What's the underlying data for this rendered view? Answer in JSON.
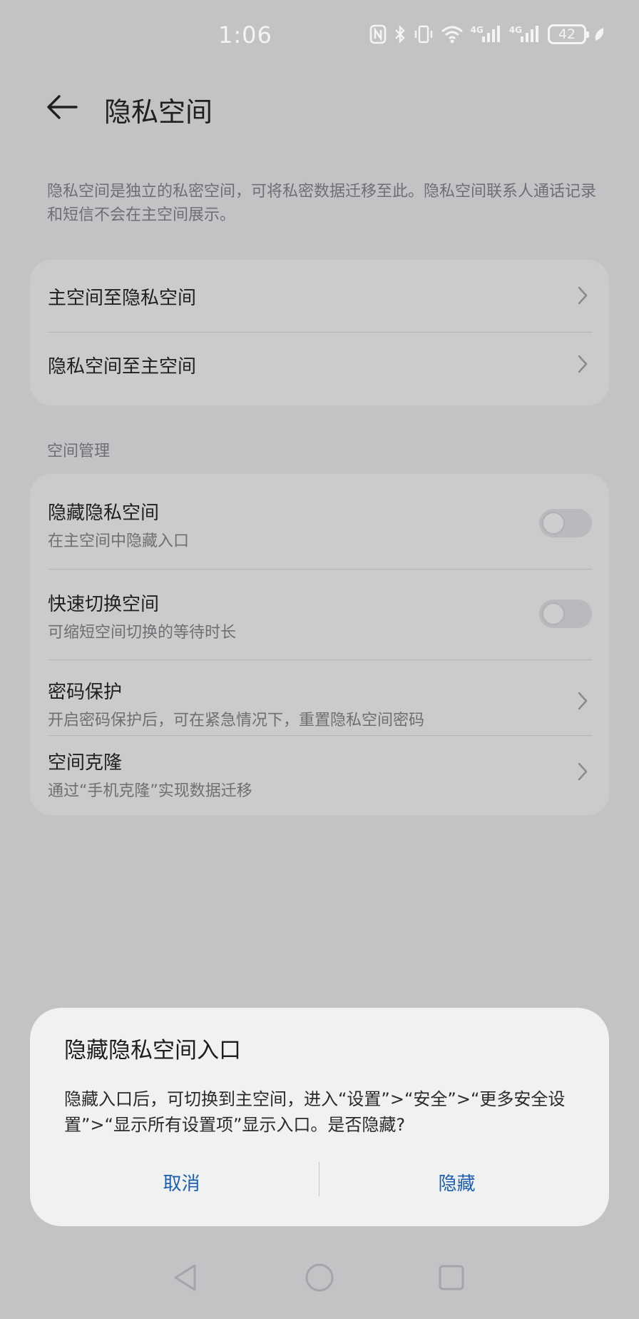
{
  "status_bar": {
    "time": "1:06",
    "battery": "42",
    "signal1_label": "4G",
    "signal2_label": "4G",
    "icons": [
      "nfc-icon",
      "bluetooth-icon",
      "vibrate-icon",
      "wifi-icon",
      "signal-icon",
      "signal-icon",
      "battery-icon",
      "leaf-icon"
    ]
  },
  "header": {
    "title": "隐私空间",
    "back_icon": "arrow-left-icon"
  },
  "intro": {
    "text": "隐私空间是独立的私密空间，可将私密数据迁移至此。隐私空间联系人通话记录和短信不会在主空间展示。"
  },
  "transfer": {
    "items": [
      {
        "title": "主空间至隐私空间"
      },
      {
        "title": "隐私空间至主空间"
      }
    ]
  },
  "space_management": {
    "label": "空间管理",
    "items": [
      {
        "title": "隐藏隐私空间",
        "subtitle": "在主空间中隐藏入口",
        "control": "toggle",
        "on": false
      },
      {
        "title": "快速切换空间",
        "subtitle": "可缩短空间切换的等待时长",
        "control": "toggle",
        "on": false
      },
      {
        "title": "密码保护",
        "subtitle": "开启密码保护后，可在紧急情况下，重置隐私空间密码",
        "control": "chevron"
      },
      {
        "title": "空间克隆",
        "subtitle": "通过“手机克隆”实现数据迁移",
        "control": "chevron"
      }
    ]
  },
  "dialog": {
    "title": "隐藏隐私空间入口",
    "body": "隐藏入口后，可切换到主空间，进入“设置”>“安全”>“更多安全设置”>“显示所有设置项”显示入口。是否隐藏?",
    "cancel_label": "取消",
    "confirm_label": "隐藏"
  },
  "colors": {
    "background": "#c2c3c5",
    "card": "#cbcbcc",
    "dialog": "#f0f1f1",
    "accent": "#1f5fb0"
  },
  "nav_bar": {
    "icons": [
      "back-triangle-icon",
      "home-circle-icon",
      "recents-square-icon"
    ]
  }
}
